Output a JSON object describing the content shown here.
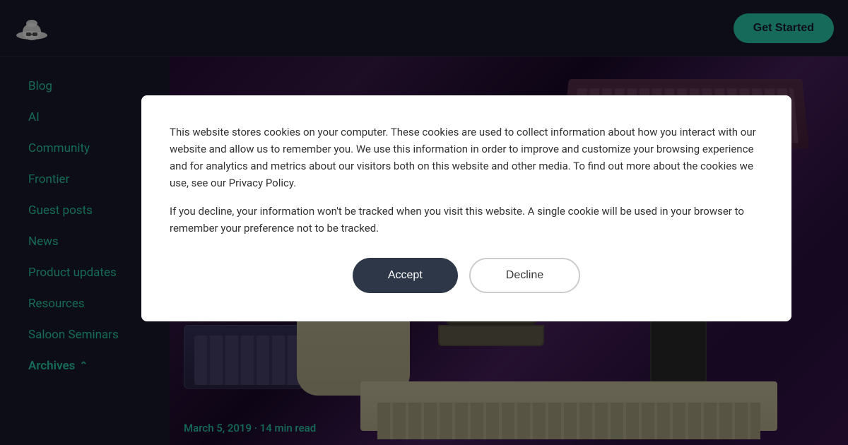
{
  "navbar": {
    "logo_alt": "Hat logo",
    "get_started_label": "Get Started"
  },
  "sidebar": {
    "items": [
      {
        "id": "blog",
        "label": "Blog"
      },
      {
        "id": "ai",
        "label": "AI"
      },
      {
        "id": "community",
        "label": "Community"
      },
      {
        "id": "frontier",
        "label": "Frontier"
      },
      {
        "id": "guest-posts",
        "label": "Guest posts"
      },
      {
        "id": "news",
        "label": "News"
      },
      {
        "id": "product-updates",
        "label": "Product updates"
      },
      {
        "id": "resources",
        "label": "Resources"
      },
      {
        "id": "saloon-seminars",
        "label": "Saloon Seminars"
      },
      {
        "id": "archives",
        "label": "Archives"
      }
    ]
  },
  "hero": {
    "post_date": "March 5, 2019",
    "read_time": "14 min read",
    "post_meta": "March 5, 2019 · 14 min read"
  },
  "cookie": {
    "text1": "This website stores cookies on your computer. These cookies are used to collect information about how you interact with our website and allow us to remember you. We use this information in order to improve and customize your browsing experience and for analytics and metrics about our visitors both on this website and other media. To find out more about the cookies we use, see our Privacy Policy.",
    "text2": "If you decline, your information won't be tracked when you visit this website. A single cookie will be used in your browser to remember your preference not to be tracked.",
    "accept_label": "Accept",
    "decline_label": "Decline"
  }
}
